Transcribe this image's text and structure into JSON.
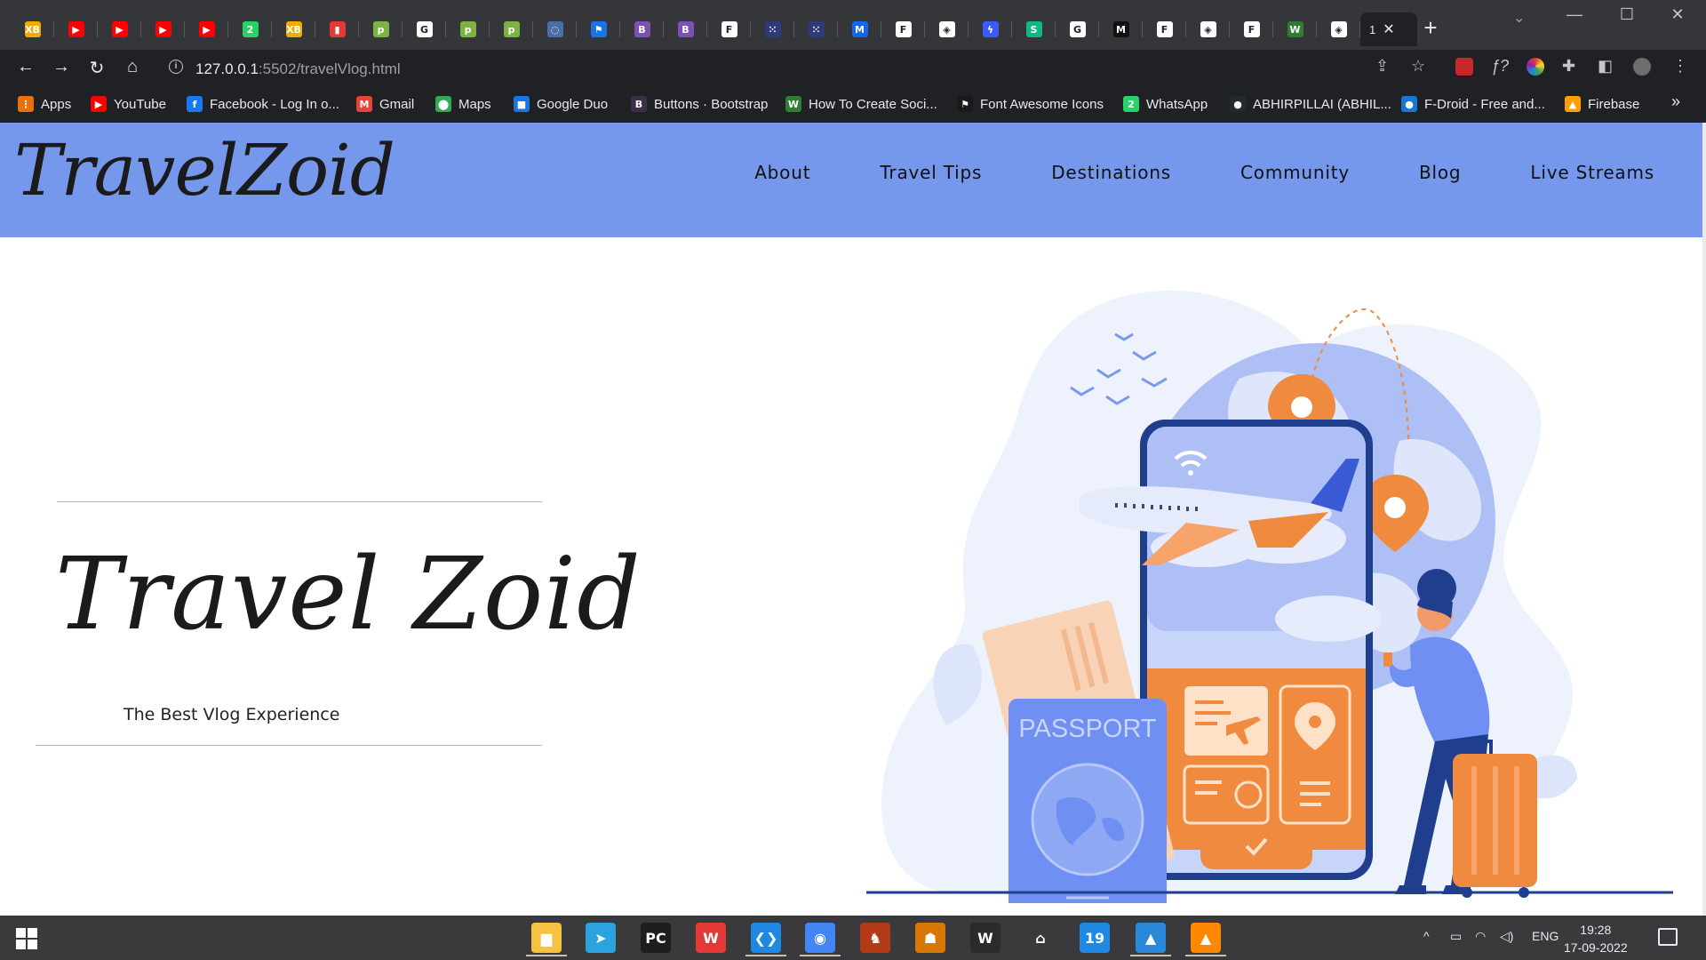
{
  "browser": {
    "tabs": [
      {
        "icon": "xb-icon",
        "color": "#f2a900",
        "glyph": "XB"
      },
      {
        "icon": "youtube-icon",
        "color": "#ff0000",
        "glyph": "▶"
      },
      {
        "icon": "youtube-icon",
        "color": "#ff0000",
        "glyph": "▶"
      },
      {
        "icon": "youtube-icon",
        "color": "#ff0000",
        "glyph": "▶"
      },
      {
        "icon": "youtube-icon",
        "color": "#ff0000",
        "glyph": "▶"
      },
      {
        "icon": "whatsapp-icon",
        "color": "#25d366",
        "glyph": "2"
      },
      {
        "icon": "xb-icon",
        "color": "#f2a900",
        "glyph": "XB"
      },
      {
        "icon": "bookmark-icon",
        "color": "#e53935",
        "glyph": "▮"
      },
      {
        "icon": "p-icon",
        "color": "#7cb342",
        "glyph": "p"
      },
      {
        "icon": "google-icon",
        "color": "#ffffff",
        "glyph": "G"
      },
      {
        "icon": "p-icon",
        "color": "#7cb342",
        "glyph": "p"
      },
      {
        "icon": "p-icon",
        "color": "#7cb342",
        "glyph": "p"
      },
      {
        "icon": "loading-icon",
        "color": "#4a6fa5",
        "glyph": "◌"
      },
      {
        "icon": "flag-icon",
        "color": "#1a73e8",
        "glyph": "⚑"
      },
      {
        "icon": "bootstrap-icon",
        "color": "#7952b3",
        "glyph": "B"
      },
      {
        "icon": "bootstrap-icon",
        "color": "#7952b3",
        "glyph": "B"
      },
      {
        "icon": "f-icon",
        "color": "#ffffff",
        "glyph": "F"
      },
      {
        "icon": "dot-icon",
        "color": "#2f3a7a",
        "glyph": "⁙"
      },
      {
        "icon": "dot-icon",
        "color": "#2f3a7a",
        "glyph": "⁙"
      },
      {
        "icon": "mdb-icon",
        "color": "#1266f1",
        "glyph": "M"
      },
      {
        "icon": "f-icon",
        "color": "#ffffff",
        "glyph": "F"
      },
      {
        "icon": "codepen-icon",
        "color": "#ffffff",
        "glyph": "◈"
      },
      {
        "icon": "bolt-icon",
        "color": "#3d5afe",
        "glyph": "ϟ"
      },
      {
        "icon": "s-icon",
        "color": "#10b981",
        "glyph": "S"
      },
      {
        "icon": "google-icon",
        "color": "#ffffff",
        "glyph": "G"
      },
      {
        "icon": "m-icon",
        "color": "#111111",
        "glyph": "M"
      },
      {
        "icon": "f-icon",
        "color": "#ffffff",
        "glyph": "F"
      },
      {
        "icon": "codepen-icon",
        "color": "#ffffff",
        "glyph": "◈"
      },
      {
        "icon": "f-icon",
        "color": "#ffffff",
        "glyph": "F"
      },
      {
        "icon": "w-icon",
        "color": "#2e7d32",
        "glyph": "W"
      },
      {
        "icon": "codepen-icon",
        "color": "#ffffff",
        "glyph": "◈"
      }
    ],
    "active_tab_label": "1",
    "url_host": "127.0.0.1",
    "url_path": ":5502/travelVlog.html",
    "bookmarks": [
      {
        "label": "Apps",
        "icon": "apps-grid-icon",
        "color": "#e8710a",
        "glyph": "⋮"
      },
      {
        "label": "YouTube",
        "icon": "youtube-icon",
        "color": "#ff0000",
        "glyph": "▶"
      },
      {
        "label": "Facebook - Log In o...",
        "icon": "facebook-icon",
        "color": "#1877f2",
        "glyph": "f"
      },
      {
        "label": "Gmail",
        "icon": "gmail-icon",
        "color": "#ea4335",
        "glyph": "M"
      },
      {
        "label": "Maps",
        "icon": "maps-icon",
        "color": "#34a853",
        "glyph": "⬤"
      },
      {
        "label": "Google Duo",
        "icon": "duo-icon",
        "color": "#1a73e8",
        "glyph": "■"
      },
      {
        "label": "Buttons · Bootstrap",
        "icon": "bootstrap-icon",
        "color": "#3b2f4a",
        "glyph": "B"
      },
      {
        "label": "How To Create Soci...",
        "icon": "w-icon",
        "color": "#2e7d32",
        "glyph": "W"
      },
      {
        "label": "Font Awesome Icons",
        "icon": "flag-icon",
        "color": "#1a1a1a",
        "glyph": "⚑"
      },
      {
        "label": "WhatsApp",
        "icon": "whatsapp-icon",
        "color": "#25d366",
        "glyph": "2"
      },
      {
        "label": "ABHIRPILLAI (ABHIL...",
        "icon": "github-icon",
        "color": "#24292e",
        "glyph": "●"
      },
      {
        "label": "F-Droid - Free and...",
        "icon": "fdroid-icon",
        "color": "#1976d2",
        "glyph": "●"
      },
      {
        "label": "Firebase",
        "icon": "firebase-icon",
        "color": "#ffa000",
        "glyph": "▲"
      }
    ]
  },
  "site": {
    "logo": "TravelZoid",
    "nav": [
      "About",
      "Travel Tips",
      "Destinations",
      "Community",
      "Blog",
      "Live Streams"
    ],
    "hero_title": "Travel Zoid",
    "hero_subtitle": "The Best Vlog Experience",
    "illustration": {
      "passport_text": "PASSPORT"
    },
    "colors": {
      "navbar": "#7698ec",
      "accent_orange": "#f08a3e",
      "illustration_blue": "#6f8ff2"
    }
  },
  "taskbar": {
    "apps": [
      {
        "icon": "file-explorer-icon",
        "color": "#f5c242",
        "glyph": "▆",
        "running": true
      },
      {
        "icon": "telegram-icon",
        "color": "#2aa3de",
        "glyph": "➤",
        "running": false
      },
      {
        "icon": "pycharm-icon",
        "color": "#1e1e1e",
        "glyph": "PC",
        "running": false
      },
      {
        "icon": "wps-icon",
        "color": "#e53935",
        "glyph": "W",
        "running": false
      },
      {
        "icon": "vscode-icon",
        "color": "#1e88e5",
        "glyph": "❮❯",
        "running": true
      },
      {
        "icon": "chrome-icon",
        "color": "#4285f4",
        "glyph": "◉",
        "running": true
      },
      {
        "icon": "game-icon",
        "color": "#b23a16",
        "glyph": "♞",
        "running": false
      },
      {
        "icon": "game-icon",
        "color": "#d97706",
        "glyph": "☗",
        "running": false
      },
      {
        "icon": "wordpress-icon",
        "color": "#2b2b2b",
        "glyph": "W",
        "running": false
      },
      {
        "icon": "game-icon",
        "color": "#3a3a3a",
        "glyph": "⌂",
        "running": false
      },
      {
        "icon": "calendar-icon",
        "color": "#1e88e5",
        "glyph": "19",
        "running": false
      },
      {
        "icon": "photos-icon",
        "color": "#2b88d8",
        "glyph": "▲",
        "running": true
      },
      {
        "icon": "vlc-icon",
        "color": "#ff8800",
        "glyph": "▲",
        "running": true
      }
    ],
    "language": "ENG",
    "time": "19:28",
    "date": "17-09-2022"
  }
}
